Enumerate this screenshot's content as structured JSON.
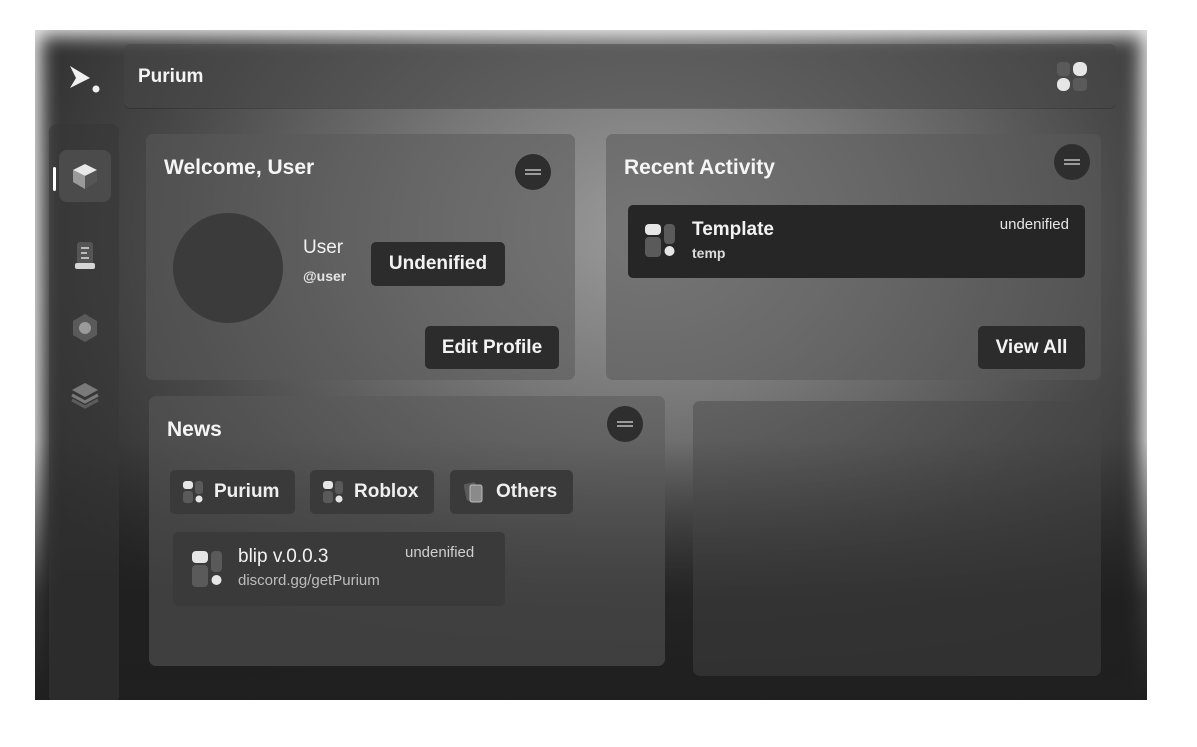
{
  "app": {
    "title": "Purium"
  },
  "sidebar": {
    "items": [
      {
        "name": "home",
        "icon": "cube-icon",
        "active": true
      },
      {
        "name": "scripts",
        "icon": "document-icon"
      },
      {
        "name": "settings",
        "icon": "hexagon-nut-icon"
      },
      {
        "name": "layers",
        "icon": "layers-icon"
      }
    ]
  },
  "welcome": {
    "title": "Welcome, User",
    "display_name": "User",
    "username": "@user",
    "status": "Undenified",
    "edit_label": "Edit Profile"
  },
  "recent": {
    "title": "Recent Activity",
    "items": [
      {
        "title": "Template",
        "subtitle": "temp",
        "meta": "undenified"
      }
    ],
    "view_all_label": "View All"
  },
  "news": {
    "title": "News",
    "filters": [
      {
        "label": "Purium",
        "icon": "grid-tile-icon"
      },
      {
        "label": "Roblox",
        "icon": "grid-tile-icon"
      },
      {
        "label": "Others",
        "icon": "cards-icon"
      }
    ],
    "items": [
      {
        "title": "blip v.0.0.3",
        "subtitle": "discord.gg/getPurium",
        "meta": "undenified"
      }
    ]
  },
  "colors": {
    "text": "#f2f2f2",
    "button": "#2c2c2c",
    "accent": "#ffffff"
  }
}
